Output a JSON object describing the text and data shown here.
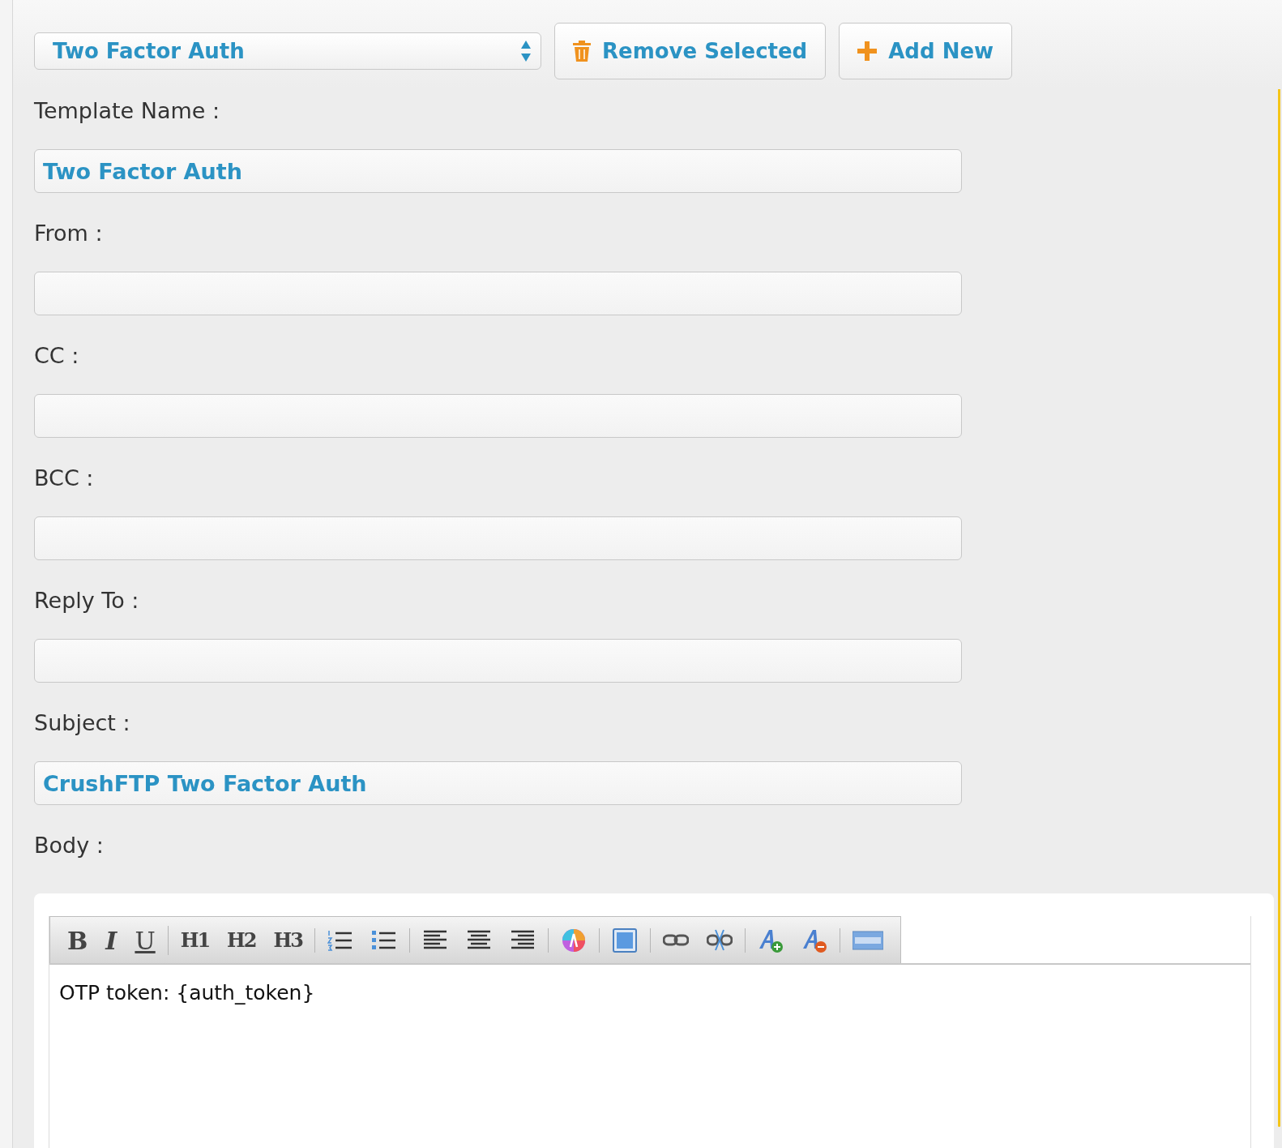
{
  "template_select": {
    "value": "Two Factor Auth"
  },
  "buttons": [
    {
      "kind": "remove",
      "label": "Remove Selected"
    },
    {
      "kind": "add",
      "label": "Add New"
    }
  ],
  "fields": [
    {
      "label": "Template Name :",
      "value": "Two Factor Auth"
    },
    {
      "label": "From :"
    },
    {
      "label": "CC :"
    },
    {
      "label": "BCC :"
    },
    {
      "label": "Reply To :"
    },
    {
      "label": "Subject :",
      "value": "CrushFTP Two Factor Auth"
    }
  ],
  "body": {
    "label": "Body :",
    "toolbar": [
      [
        {
          "kind": "bold",
          "label": "B"
        },
        {
          "kind": "italic",
          "label": "I"
        },
        {
          "kind": "underline",
          "label": "U"
        }
      ],
      [
        {
          "kind": "heading",
          "label": "H1"
        },
        {
          "kind": "heading",
          "label": "H2"
        },
        {
          "kind": "heading",
          "label": "H3"
        }
      ],
      [
        {
          "kind": "ordered-list"
        },
        {
          "kind": "bullet-list"
        }
      ],
      [
        {
          "kind": "align-left"
        },
        {
          "kind": "align-center"
        },
        {
          "kind": "align-right"
        }
      ],
      [
        {
          "kind": "color"
        }
      ],
      [
        {
          "kind": "image"
        }
      ],
      [
        {
          "kind": "link"
        },
        {
          "kind": "unlink"
        }
      ],
      [
        {
          "kind": "font-plus"
        },
        {
          "kind": "font-minus"
        }
      ],
      [
        {
          "kind": "html"
        }
      ]
    ],
    "content": "OTP token: {auth_token}"
  }
}
